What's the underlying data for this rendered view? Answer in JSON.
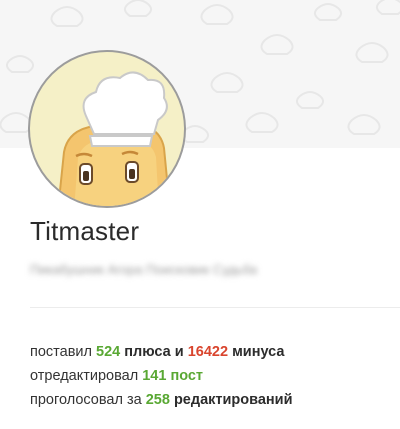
{
  "profile": {
    "username": "Titmaster",
    "subtitle": "Пикабушник Агора Поисковик Судьба",
    "avatar_icon": "chef-pastry-avatar-icon"
  },
  "stats": {
    "plus": {
      "prefix": "поставил",
      "plus_count": "524",
      "plus_word": "плюса",
      "and": "и",
      "minus_count": "16422",
      "minus_word": "минуса"
    },
    "edited": {
      "prefix": "отредактировал",
      "count": "141",
      "word": "пост"
    },
    "voted": {
      "prefix": "проголосовал за",
      "count": "258",
      "word": "редактирований"
    }
  },
  "colors": {
    "positive": "#59a833",
    "negative": "#d9452e",
    "cover_bg": "#f6f6f6",
    "avatar_bg": "#f5f0c7"
  }
}
